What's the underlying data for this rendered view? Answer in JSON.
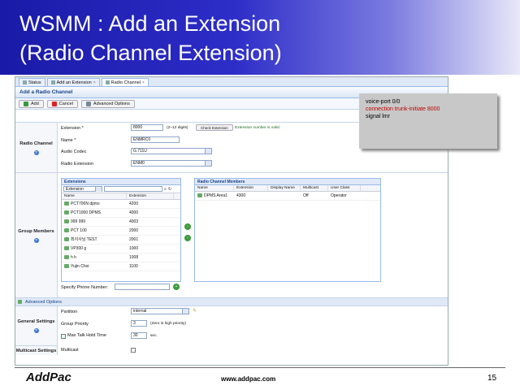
{
  "slide": {
    "title_line1": "WSMM : Add an Extension",
    "title_line2": "(Radio Channel Extension)",
    "logo": "AddPac",
    "url": "www.addpac.com",
    "page": "15"
  },
  "tabs": [
    {
      "label": "Status"
    },
    {
      "label": "Add an Extension"
    },
    {
      "label": "Radio Channel"
    }
  ],
  "panel": {
    "title": "Add a Radio Channel"
  },
  "toolbar": {
    "add": "Add",
    "cancel": "Cancel",
    "advanced": "Advanced Options"
  },
  "radio_channel": {
    "section": "Radio Channel",
    "extension_label": "Extension *",
    "extension_value": "8000",
    "extension_hint": "(2~12 digits)",
    "check_btn": "Check Extension",
    "valid_msg": "Extension number is valid.",
    "name_label": "Name *",
    "name_value": "ENMRC0",
    "codec_label": "Audio Codec",
    "codec_value": "G.711U",
    "radio_ext_label": "Radio Extension",
    "radio_ext_value": "ENM0"
  },
  "group_members": {
    "section": "Group Members",
    "ext_grid": {
      "title": "Extensions",
      "filter": "Extension",
      "col_name": "Name",
      "col_ext": "Extension",
      "rows": [
        {
          "name": "PCT700N dpms",
          "ext": "4200"
        },
        {
          "name": "PCT1000 DPMS",
          "ext": "4000"
        },
        {
          "name": "999 999",
          "ext": "4003"
        },
        {
          "name": "PCT 100",
          "ext": "2000"
        },
        {
          "name": "최이사님 TEST",
          "ext": "2001"
        },
        {
          "name": "VP300 g",
          "ext": "1000"
        },
        {
          "name": "h h",
          "ext": "1008"
        },
        {
          "name": "Yujin Choi",
          "ext": "1100"
        }
      ]
    },
    "specify_label": "Specify Phone Number:",
    "members_grid": {
      "title": "Radio Channel Members",
      "cols": [
        "Name",
        "Extension",
        "Display Name",
        "Multicast",
        "User Class"
      ],
      "rows": [
        {
          "name": "DPMS Area1",
          "ext": "4300",
          "display": "",
          "multicast": "Off",
          "user_class": "Operator"
        }
      ]
    }
  },
  "advanced": {
    "header": "Advanced Options",
    "general_section": "General Settings",
    "partition_label": "Partition",
    "partition_value": "internal",
    "priority_label": "Group Priority",
    "priority_value": "3",
    "priority_hint": "(Zero is high priority)",
    "maxtalk_label": "Max Talk Hold Time",
    "maxtalk_value": "30",
    "maxtalk_unit": "sec.",
    "multicast_section": "Multicast Settings",
    "multicast_label": "Multicast"
  },
  "console": {
    "line1": "voice-port 0/0",
    "line2": "connection trunk-initiate 8000",
    "line3": "signal lmr"
  }
}
